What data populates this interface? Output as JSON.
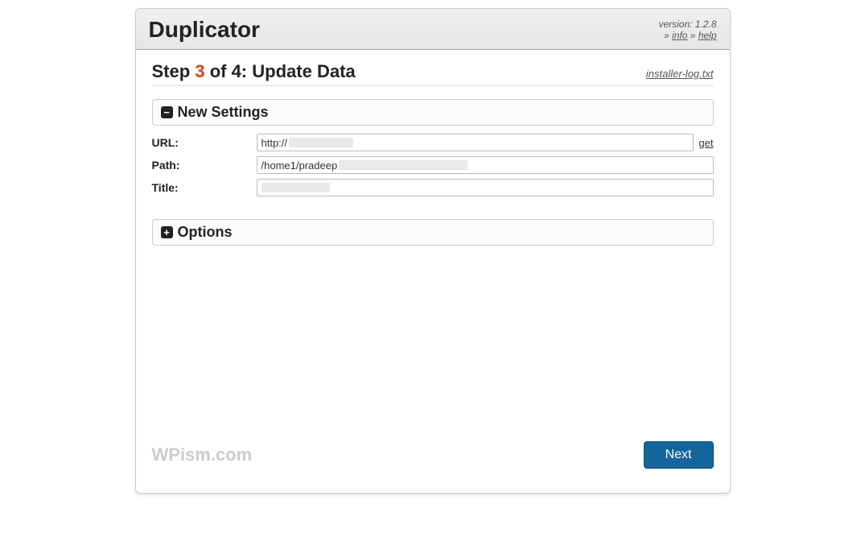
{
  "header": {
    "title": "Duplicator",
    "version_label": "version: 1.2.8",
    "info_link": "info",
    "help_link": "help"
  },
  "step": {
    "prefix": "Step",
    "number": "3",
    "middle": "of 4:",
    "name": "Update Data",
    "log_link": "installer-log.txt"
  },
  "panels": {
    "new_settings": {
      "title": "New Settings",
      "fields": {
        "url": {
          "label": "URL:",
          "value_prefix": "http://",
          "get_link": "get"
        },
        "path": {
          "label": "Path:",
          "value_prefix": "/home1/pradeep"
        },
        "title": {
          "label": "Title:"
        }
      }
    },
    "options": {
      "title": "Options"
    }
  },
  "footer": {
    "watermark": "WPism.com",
    "next_button": "Next"
  }
}
